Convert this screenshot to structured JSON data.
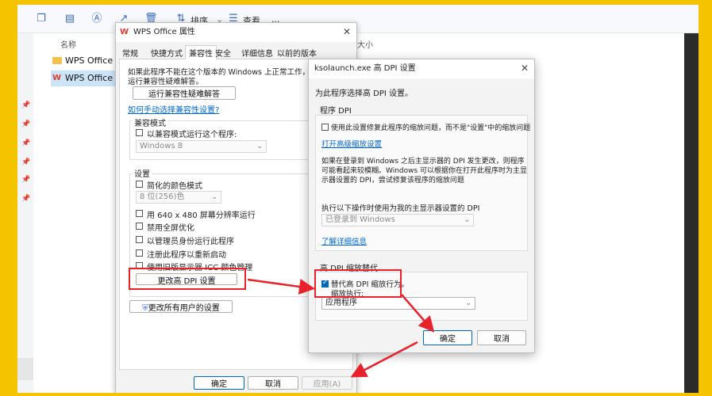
{
  "explorer": {
    "toolbar": {
      "sort_label": "排序",
      "view_label": "查看",
      "more_label": "..."
    },
    "columns": {
      "name": "名称",
      "size": "大小"
    },
    "files": [
      {
        "name": "WPS Office 工具",
        "type": "folder"
      },
      {
        "name": "WPS Office",
        "type": "wps",
        "selected": true
      }
    ]
  },
  "props_dialog": {
    "title": "WPS Office 属性",
    "tabs": [
      "常规",
      "快捷方式",
      "兼容性",
      "安全",
      "详细信息",
      "以前的版本"
    ],
    "active_tab": "兼容性",
    "intro_line1": "如果此程序不能在这个版本的 Windows 上正常工作，请尝试",
    "intro_line2": "运行兼容性疑难解答。",
    "troubleshoot_button": "运行兼容性疑难解答",
    "manual_link": "如何手动选择兼容性设置?",
    "compat_mode_group": "兼容模式",
    "compat_mode_check": "以兼容模式运行这个程序:",
    "compat_mode_combo": "Windows 8",
    "settings_group": "设置",
    "reduced_color": "简化的颜色模式",
    "color_combo": "8 位(256)色",
    "res_640": "用 640 x 480 屏幕分辨率运行",
    "disable_fullscreen": "禁用全屏优化",
    "run_as_admin": "以管理员身份运行此程序",
    "register_restart": "注册此程序以重新启动",
    "legacy_icc": "使用旧版显示器 ICC 颜色管理",
    "change_dpi_button": "更改高 DPI 设置",
    "all_users_button": "更改所有用户的设置",
    "ok_button": "确定",
    "cancel_button": "取消",
    "apply_button": "应用(A)"
  },
  "dpi_dialog": {
    "title": "ksolaunch.exe 高 DPI 设置",
    "heading": "为此程序选择高 DPI 设置。",
    "program_dpi_group": "程序 DPI",
    "program_dpi_check": "使用此设置修复此程序的缩放问题，而不是\"设置\"中的缩放问题",
    "advanced_link": "打开高级缩放设置",
    "blur_line1": "如果在登录到 Windows 之后主显示器的 DPI 发生更改，则程序",
    "blur_line2": "可能看起来较模糊。Windows 可以根据你在打开此程序时为主显",
    "blur_line3": "示器设置的 DPI，尝试修复该程序的缩放问题",
    "use_dpi_label": "执行以下操作时使用为我的主显示器设置的 DPI",
    "use_dpi_combo": "已登录到 Windows",
    "learn_more_link": "了解详细信息",
    "override_group": "高 DPI 缩放替代",
    "override_check_line1": "替代高 DPI 缩放行为。",
    "override_check_line2": "缩放执行:",
    "override_combo": "应用程序",
    "ok_button": "确定",
    "cancel_button": "取消"
  },
  "colors": {
    "frame": "#f5c400",
    "annotation_red": "#e8212b",
    "accent_blue": "#0067c0"
  }
}
